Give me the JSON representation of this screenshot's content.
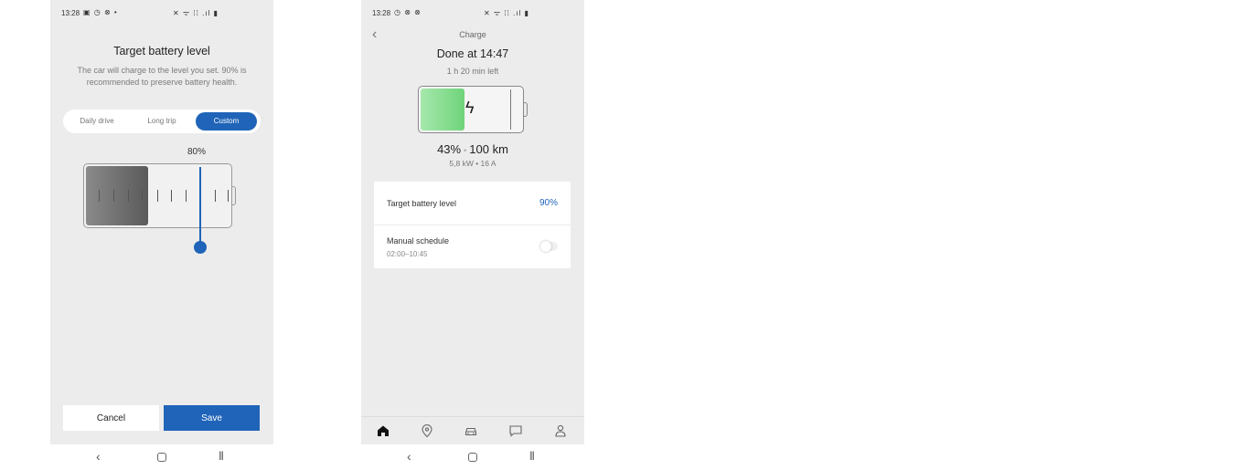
{
  "phone1": {
    "status": {
      "time": "13:28",
      "left_icons": "▣ ◷ ⊗ •",
      "right_icons": "✕ ᯤ ⁞⁞ .ıl ▮"
    },
    "title": "Target battery level",
    "description": "The car will charge to the level you set. 90% is recommended to preserve battery health.",
    "segments": [
      "Daily drive",
      "Long trip",
      "Custom"
    ],
    "selected_segment": "Custom",
    "battery_label": "80%",
    "battery_level_fraction": 0.43,
    "slider_value_percent": 80,
    "cancel_label": "Cancel",
    "save_label": "Save",
    "accent": "#1f64b8"
  },
  "phone2": {
    "status": {
      "time": "13:28",
      "left_icons": "◷ ⊗ ⊗",
      "right_icons": "✕ ᯤ ⁞⁞ .ıl ▮"
    },
    "header": "Charge",
    "done": "Done at 14:47",
    "time_left": "1 h 20 min left",
    "battery_percent": "43%",
    "range": "100 km",
    "power": "5,8 kW • 16 A",
    "battery_level_fraction": 0.43,
    "target_label": "Target battery level",
    "target_value": "90%",
    "schedule_label": "Manual schedule",
    "schedule_time": "02:00–10:45",
    "schedule_enabled": false,
    "tabs": [
      "home-icon",
      "location-pin-icon",
      "car-icon",
      "chat-icon",
      "profile-icon"
    ],
    "active_tab": "home-icon",
    "fill_color": "#6fd47a"
  },
  "navbar": {
    "back": "‹",
    "recent": "|||"
  }
}
